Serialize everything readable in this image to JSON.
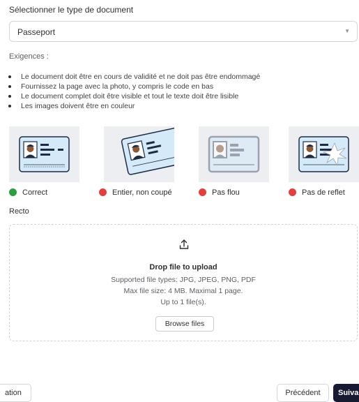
{
  "doc_type": {
    "label": "Sélectionner le type de document",
    "selected": "Passeport",
    "caret_icon": "chevron-down-icon"
  },
  "requirements": {
    "title": "Exigences :",
    "items": [
      "Le document doit être en cours de validité et ne doit pas être endommagé",
      "Fournissez la page avec la photo, y compris le code en bas",
      "Le document complet doit être visible et tout le texte doit être lisible",
      "Les images doivent être en couleur"
    ]
  },
  "examples": [
    {
      "label": "Correct",
      "status": "ok",
      "color": "#2e9e44"
    },
    {
      "label": "Entier, non coupé",
      "status": "error",
      "color": "#e0413b"
    },
    {
      "label": "Pas flou",
      "status": "error",
      "color": "#e0413b"
    },
    {
      "label": "Pas de reflet",
      "status": "error",
      "color": "#e0413b"
    }
  ],
  "recto": {
    "label": "Recto",
    "upload_icon": "upload-icon",
    "drop_title": "Drop file to upload",
    "supported": "Supported file types: JPG, JPEG, PNG, PDF",
    "max_size": "Max file size: 4 MB. Maximal 1 page.",
    "count": "Up to 1 file(s).",
    "browse": "Browse files"
  },
  "footer": {
    "left_button": "ation",
    "previous": "Précédent",
    "next": "Suiva"
  },
  "colors": {
    "accent_dark": "#161a33",
    "ok": "#2e9e44",
    "error": "#e0413b"
  }
}
